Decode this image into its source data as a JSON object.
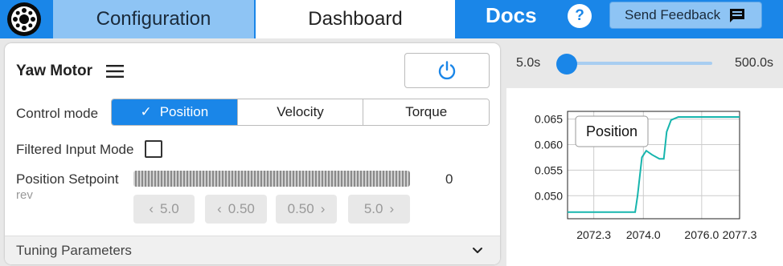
{
  "header": {
    "logo_icon": "motor-logo-icon",
    "tabs": [
      {
        "label": "Configuration",
        "active": false
      },
      {
        "label": "Dashboard",
        "active": true
      }
    ],
    "docs_label": "Docs",
    "help_label": "?",
    "feedback_label": "Send Feedback",
    "feedback_icon": "feedback-message-icon"
  },
  "motor": {
    "name": "Yaw Motor",
    "menu_icon": "hamburger-menu-icon",
    "power_icon": "power-icon",
    "control_mode_label": "Control mode",
    "modes": [
      {
        "label": "Position",
        "active": true
      },
      {
        "label": "Velocity",
        "active": false
      },
      {
        "label": "Torque",
        "active": false
      }
    ],
    "filtered_input_label": "Filtered Input Mode",
    "filtered_input_checked": false,
    "setpoint_label": "Position Setpoint",
    "setpoint_unit": "rev",
    "setpoint_value": "0",
    "step_buttons": [
      {
        "label": "5.0",
        "direction": "left"
      },
      {
        "label": "0.50",
        "direction": "left"
      },
      {
        "label": "0.50",
        "direction": "right"
      },
      {
        "label": "5.0",
        "direction": "right"
      }
    ],
    "tuning_label": "Tuning Parameters"
  },
  "time_window": {
    "min_label": "5.0s",
    "max_label": "500.0s",
    "value": 5.0
  },
  "colors": {
    "accent": "#1a86e8",
    "plot_line": "#17b5ad"
  },
  "chart_data": {
    "type": "line",
    "title": "Position",
    "xlabel": "",
    "ylabel": "",
    "xlim": [
      2071.4,
      2077.3
    ],
    "ylim": [
      0.0455,
      0.0665
    ],
    "x_ticks": [
      "2072.3",
      "2074.0",
      "2076.0",
      "2077.3"
    ],
    "y_ticks": [
      "0.065",
      "0.060",
      "0.055",
      "0.050"
    ],
    "grid": true,
    "series": [
      {
        "x": [
          2071.4,
          2073.5,
          2073.72,
          2073.8,
          2073.95,
          2074.1,
          2074.3,
          2074.55,
          2074.7,
          2074.8,
          2074.95,
          2075.2,
          2075.6,
          2076.0,
          2076.5,
          2077.3
        ],
        "y": [
          0.0468,
          0.0468,
          0.0468,
          0.05,
          0.0575,
          0.0588,
          0.058,
          0.0572,
          0.0572,
          0.0625,
          0.0648,
          0.0654,
          0.0654,
          0.0654,
          0.0654,
          0.0654
        ]
      }
    ]
  }
}
